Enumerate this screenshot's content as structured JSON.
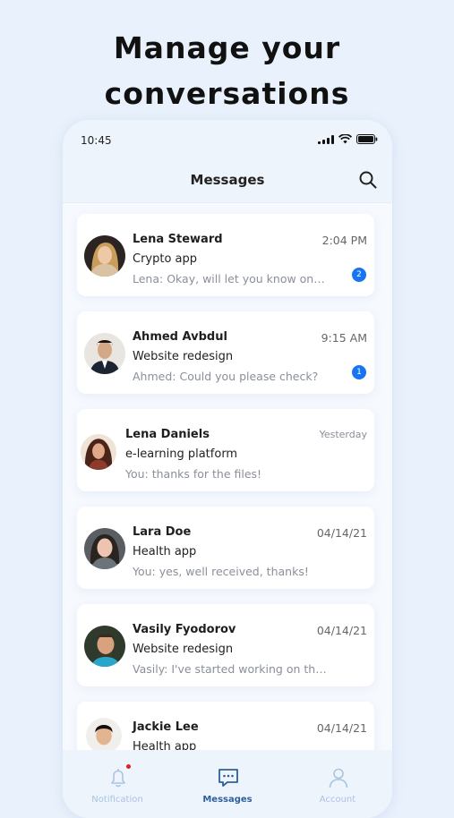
{
  "headline": {
    "line1": "Manage your",
    "line2": "conversations"
  },
  "status_bar": {
    "time": "10:45"
  },
  "header": {
    "title": "Messages",
    "search_icon": "search-icon"
  },
  "conversations": [
    {
      "name": "Lena Steward",
      "project": "Crypto app",
      "preview": "Lena: Okay, will let you know onc...",
      "time": "2:04 PM",
      "unread": "2"
    },
    {
      "name": "Ahmed Avbdul",
      "project": "Website redesign",
      "preview": "Ahmed: Could you please check?",
      "time": "9:15 AM",
      "unread": "1"
    },
    {
      "name": "Lena Daniels",
      "project": "e-learning platform",
      "preview": "You: thanks for the files!",
      "time": "Yesterday"
    },
    {
      "name": "Lara Doe",
      "project": "Health app",
      "preview": "You: yes, well received, thanks!",
      "time": "04/14/21"
    },
    {
      "name": "Vasily Fyodorov",
      "project": "Website redesign",
      "preview": "Vasily: I've started working on the draft...",
      "time": "04/14/21"
    },
    {
      "name": "Jackie Lee",
      "project": "Health  app",
      "preview": "",
      "time": "04/14/21"
    }
  ],
  "tabbar": {
    "notification": "Notification",
    "messages": "Messages",
    "account": "Account"
  },
  "colors": {
    "accent": "#1774f2",
    "background": "#e9f1fc",
    "active_tab": "#2f5f9a",
    "inactive_tab": "#aac3e2"
  }
}
